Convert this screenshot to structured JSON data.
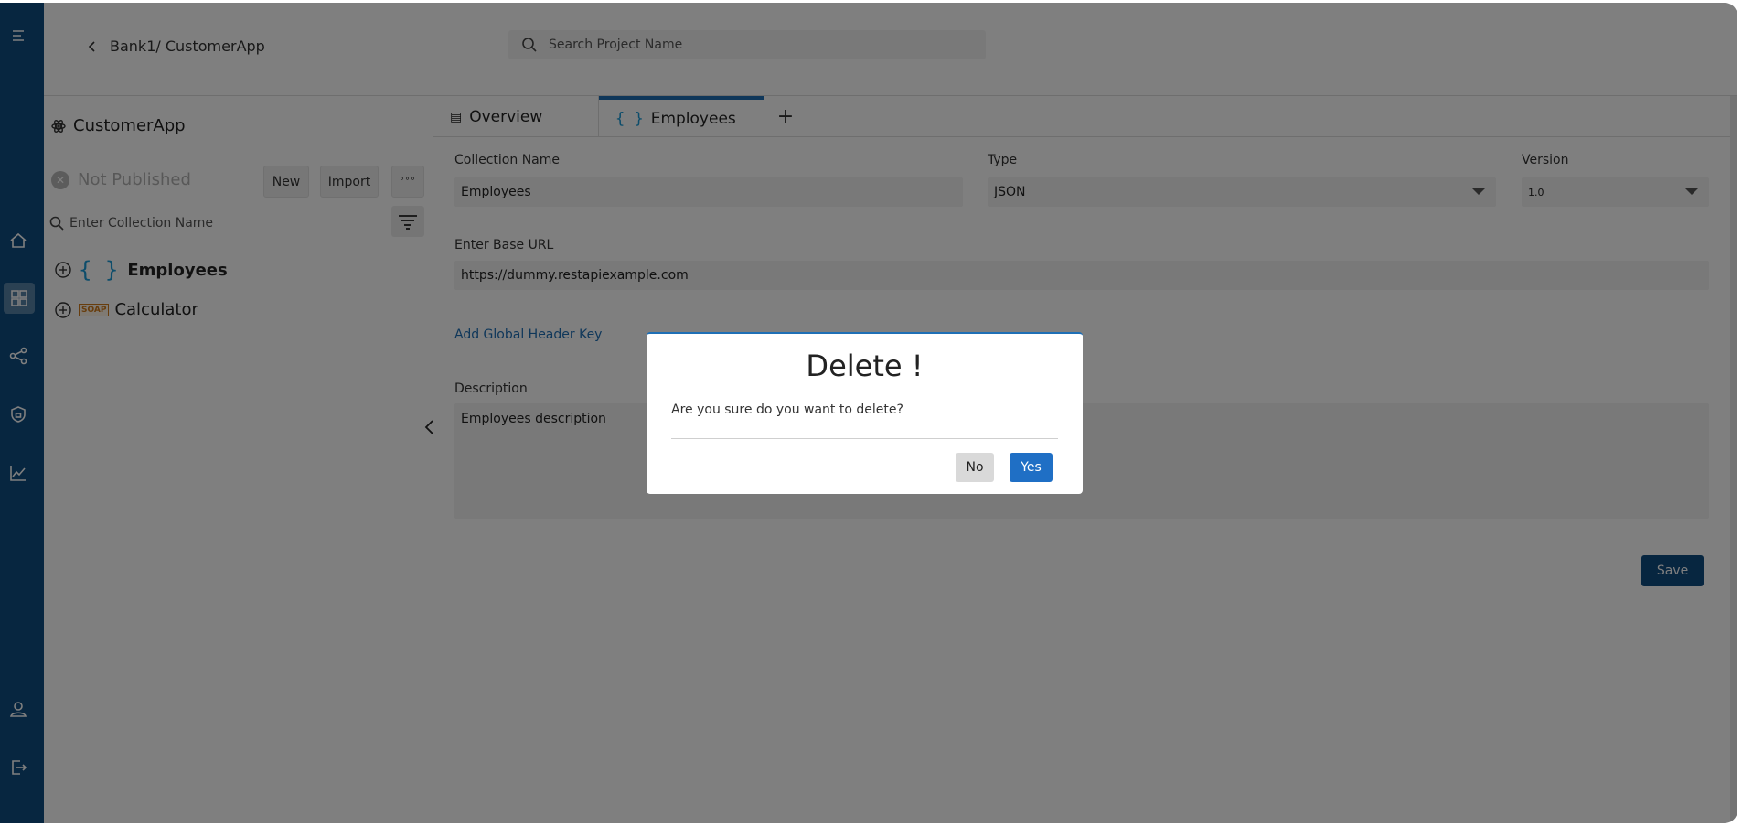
{
  "header": {
    "breadcrumb": "Bank1/ CustomerApp",
    "search_placeholder": "Search Project Name"
  },
  "rail": {
    "items": [
      "menu-icon",
      "home-icon",
      "dashboard-icon",
      "share-icon",
      "shield-icon",
      "chart-icon",
      "user-icon",
      "logout-icon"
    ],
    "active": "dashboard-icon",
    "color": "#0f4c81"
  },
  "left_panel": {
    "project_name": "CustomerApp",
    "status": "Not Published",
    "new_label": "New",
    "import_label": "Import",
    "more_label": "°°°",
    "search_placeholder": "Enter Collection Name",
    "collections": [
      {
        "name": "Employees",
        "type": "{ }"
      },
      {
        "name": "Calculator",
        "type": "SOAP"
      }
    ]
  },
  "tabs": [
    {
      "label": "Overview"
    },
    {
      "label": "Employees",
      "active": true
    }
  ],
  "tab_add": "+",
  "form": {
    "collection_name_label": "Collection Name",
    "collection_name_value": "Employees",
    "type_label": "Type",
    "type_value": "JSON",
    "version_label": "Version",
    "version_value": "1.0",
    "base_url_label": "Enter Base URL",
    "base_url_value": "https://dummy.restapiexample.com",
    "add_header_key": "Add Global Header Key",
    "description_label": "Description",
    "description_value": "Employees description",
    "save_label": "Save"
  },
  "modal": {
    "title": "Delete !",
    "message": "Are you sure do you want to delete?",
    "no_label": "No",
    "yes_label": "Yes"
  },
  "colors": {
    "primary": "#0f4c81",
    "accent": "#1f6fc5",
    "link": "#1f6fb5",
    "json_brace": "#1b9ad6",
    "soap": "#d07a1a"
  }
}
